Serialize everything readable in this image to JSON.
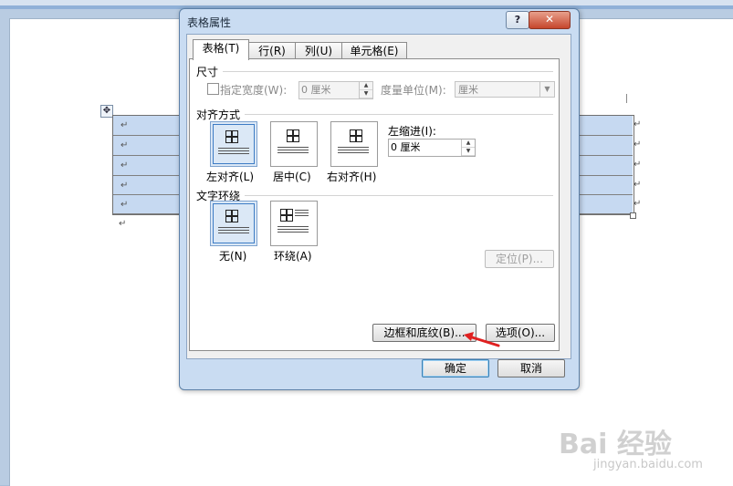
{
  "dialog": {
    "title": "表格属性",
    "help_glyph": "?",
    "close_glyph": "✕",
    "tabs": [
      {
        "label": "表格(T)"
      },
      {
        "label": "行(R)"
      },
      {
        "label": "列(U)"
      },
      {
        "label": "单元格(E)"
      }
    ],
    "size": {
      "section_label": "尺寸",
      "preferred_width_label": "指定宽度(W):",
      "preferred_width_value": "0 厘米",
      "unit_label": "度量单位(M):",
      "unit_value": "厘米"
    },
    "alignment": {
      "section_label": "对齐方式",
      "options": [
        {
          "label": "左对齐(L)"
        },
        {
          "label": "居中(C)"
        },
        {
          "label": "右对齐(H)"
        }
      ],
      "indent_label": "左缩进(I):",
      "indent_value": "0 厘米"
    },
    "wrapping": {
      "section_label": "文字环绕",
      "options": [
        {
          "label": "无(N)"
        },
        {
          "label": "环绕(A)"
        }
      ],
      "positioning_button": "定位(P)..."
    },
    "borders_button": "边框和底纹(B)...",
    "options_button": "选项(O)...",
    "ok_button": "确定",
    "cancel_button": "取消"
  },
  "document": {
    "paragraph_mark": "↵",
    "move_handle_glyph": "✥"
  },
  "watermark": {
    "brand": "Bai 经验",
    "url": "jingyan.baidu.com"
  },
  "colors": {
    "table_cell_fill": "#c6d9f1",
    "dialog_frame": "#c9dcf2",
    "close_button": "#c6462c",
    "selection_highlight": "#dbe8f6",
    "annotation_arrow": "#e02020"
  }
}
